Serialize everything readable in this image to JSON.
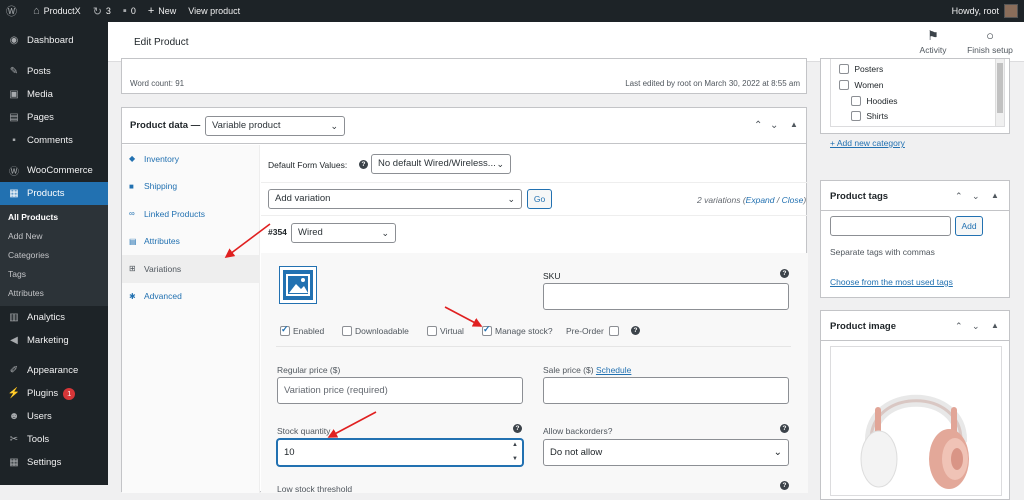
{
  "adminbar": {
    "site": "ProductX",
    "updates": "3",
    "comments": "0",
    "new": "New",
    "view": "View product",
    "howdy": "Howdy, root"
  },
  "sidebar": {
    "items": [
      {
        "label": "Dashboard",
        "icon": "dashboard-icon"
      },
      {
        "label": "Posts",
        "icon": "pin-icon"
      },
      {
        "label": "Media",
        "icon": "media-icon"
      },
      {
        "label": "Pages",
        "icon": "page-icon"
      },
      {
        "label": "Comments",
        "icon": "comment-icon"
      },
      {
        "label": "WooCommerce",
        "icon": "woo-icon"
      },
      {
        "label": "Products",
        "icon": "products-icon"
      }
    ],
    "sub": [
      "All Products",
      "Add New",
      "Categories",
      "Tags",
      "Attributes"
    ],
    "items2": [
      {
        "label": "Analytics",
        "icon": "analytics-icon"
      },
      {
        "label": "Marketing",
        "icon": "marketing-icon"
      },
      {
        "label": "Appearance",
        "icon": "brush-icon"
      },
      {
        "label": "Plugins",
        "icon": "plugin-icon",
        "badge": "1"
      },
      {
        "label": "Users",
        "icon": "users-icon"
      },
      {
        "label": "Tools",
        "icon": "tools-icon"
      },
      {
        "label": "Settings",
        "icon": "settings-icon"
      }
    ]
  },
  "topbar": {
    "title": "Edit Product",
    "activity": "Activity",
    "finish": "Finish setup"
  },
  "wordbox": {
    "count": "Word count: 91",
    "edited": "Last edited by root on March 30, 2022 at 8:55 am"
  },
  "product_data": {
    "label": "Product data —",
    "type": "Variable product",
    "tabs": [
      "Inventory",
      "Shipping",
      "Linked Products",
      "Attributes",
      "Variations",
      "Advanced"
    ],
    "default_form_label": "Default Form Values:",
    "default_form_value": "No default Wired/Wireless...",
    "add_variation": "Add variation",
    "go": "Go",
    "variations_count": "2 variations",
    "expand": "Expand",
    "close": "Close",
    "variation_id": "#354",
    "variation_value": "Wired",
    "sku_label": "SKU",
    "checkboxes": {
      "enabled": "Enabled",
      "downloadable": "Downloadable",
      "virtual": "Virtual",
      "manage_stock": "Manage stock?",
      "preorder": "Pre-Order"
    },
    "regular_price_label": "Regular price ($)",
    "regular_price_placeholder": "Variation price (required)",
    "sale_price_label": "Sale price ($)",
    "schedule": "Schedule",
    "stock_qty_label": "Stock quantity",
    "stock_qty_value": "10",
    "backorders_label": "Allow backorders?",
    "backorders_value": "Do not allow",
    "low_stock_label": "Low stock threshold"
  },
  "categories": {
    "items": [
      "Posters",
      "Women",
      "Hoodies",
      "Shirts"
    ],
    "add": "+ Add new category"
  },
  "tags": {
    "title": "Product tags",
    "add": "Add",
    "hint": "Separate tags with commas",
    "choose": "Choose from the most used tags"
  },
  "image": {
    "title": "Product image"
  }
}
